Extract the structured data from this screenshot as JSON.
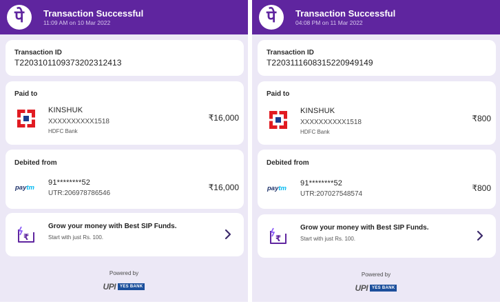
{
  "colors": {
    "header_bg": "#5f259f",
    "page_bg": "#ece8f6",
    "hdfc_red": "#e11b22",
    "hdfc_blue": "#1a3d8f"
  },
  "icons": {
    "logo": "phonepe-logo",
    "bank": "hdfc-logo",
    "wallet": "paytm-logo",
    "sip": "rupee-sip-icon",
    "chevron": "chevron-right-icon"
  },
  "panels": [
    {
      "header": {
        "logo_glyph": "पे",
        "title": "Transaction Successful",
        "subtitle": "11:09 AM on 10 Mar 2022"
      },
      "transaction": {
        "label": "Transaction ID",
        "id": "T2203101109373202312413"
      },
      "paid_to": {
        "label": "Paid to",
        "name": "KINSHUK",
        "account": "XXXXXXXXXX1518",
        "bank": "HDFC Bank",
        "amount": "₹16,000"
      },
      "debited_from": {
        "label": "Debited from",
        "logo_part1": "pay",
        "logo_part2": "tm",
        "account": "91********52",
        "utr": "UTR:206978786546",
        "amount": "₹16,000"
      },
      "sip": {
        "title": "Grow your money with Best SIP Funds.",
        "subtitle": "Start with just Rs. 100."
      },
      "footer": {
        "powered_by": "Powered by",
        "upi": "UPI",
        "bank_badge": "YES BANK"
      }
    },
    {
      "header": {
        "logo_glyph": "पे",
        "title": "Transaction Successful",
        "subtitle": "04:08 PM on 11 Mar 2022"
      },
      "transaction": {
        "label": "Transaction ID",
        "id": "T2203111608315220949149"
      },
      "paid_to": {
        "label": "Paid to",
        "name": "KINSHUK",
        "account": "XXXXXXXXXX1518",
        "bank": "HDFC Bank",
        "amount": "₹800"
      },
      "debited_from": {
        "label": "Debited from",
        "logo_part1": "pay",
        "logo_part2": "tm",
        "account": "91********52",
        "utr": "UTR:207027548574",
        "amount": "₹800"
      },
      "sip": {
        "title": "Grow your money with Best SIP Funds.",
        "subtitle": "Start with just Rs. 100."
      },
      "footer": {
        "powered_by": "Powered by",
        "upi": "UPI",
        "bank_badge": "YES BANK"
      }
    }
  ]
}
